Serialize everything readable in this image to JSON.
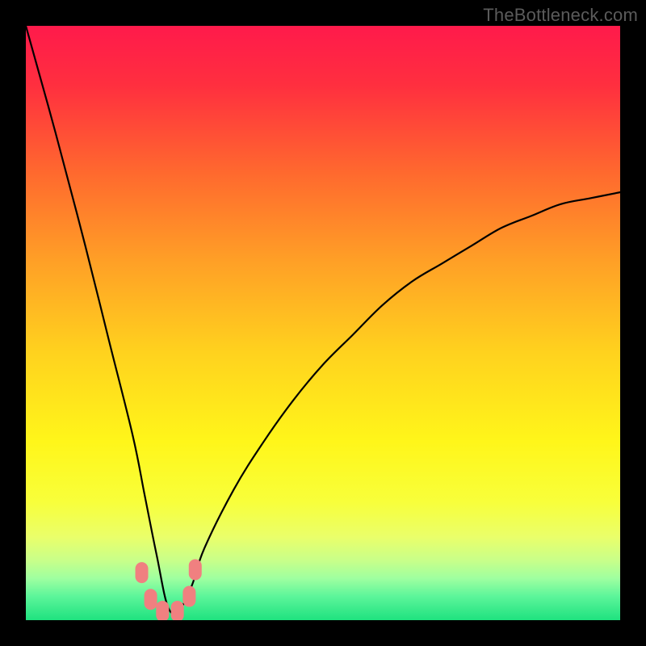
{
  "watermark": "TheBottleneck.com",
  "chart_data": {
    "type": "line",
    "title": "",
    "xlabel": "",
    "ylabel": "",
    "xlim": [
      0,
      100
    ],
    "ylim": [
      0,
      100
    ],
    "grid": false,
    "notes": "Single V-shaped bottleneck-percentage curve over a red-yellow-green heat gradient. Minimum (≈0) near x≈24 where small pink marker capsules sit; curve rises steeply to ≈100 at x=0 and more slowly toward ≈72 at x=100.",
    "series": [
      {
        "name": "bottleneck-curve",
        "x": [
          0,
          5,
          10,
          14,
          18,
          20,
          22,
          24,
          26,
          28,
          30,
          35,
          40,
          45,
          50,
          55,
          60,
          65,
          70,
          75,
          80,
          85,
          90,
          95,
          100
        ],
        "values": [
          100,
          82,
          63,
          47,
          31,
          21,
          11,
          2,
          2,
          6,
          12,
          22,
          30,
          37,
          43,
          48,
          53,
          57,
          60,
          63,
          66,
          68,
          70,
          71,
          72
        ]
      }
    ],
    "markers": {
      "name": "pink-dots",
      "color": "#f08080",
      "points": [
        {
          "x": 19.5,
          "y": 8.0
        },
        {
          "x": 21.0,
          "y": 3.5
        },
        {
          "x": 23.0,
          "y": 1.5
        },
        {
          "x": 25.5,
          "y": 1.5
        },
        {
          "x": 27.5,
          "y": 4.0
        },
        {
          "x": 28.5,
          "y": 8.5
        }
      ]
    },
    "gradient_stops": [
      {
        "offset": 0.0,
        "color": "#ff1a4b"
      },
      {
        "offset": 0.1,
        "color": "#ff2f3f"
      },
      {
        "offset": 0.25,
        "color": "#ff6a2e"
      },
      {
        "offset": 0.4,
        "color": "#ffa126"
      },
      {
        "offset": 0.55,
        "color": "#ffd21e"
      },
      {
        "offset": 0.7,
        "color": "#fff61a"
      },
      {
        "offset": 0.8,
        "color": "#f8ff3a"
      },
      {
        "offset": 0.86,
        "color": "#eaff6a"
      },
      {
        "offset": 0.9,
        "color": "#c8ff8a"
      },
      {
        "offset": 0.93,
        "color": "#9effa0"
      },
      {
        "offset": 0.96,
        "color": "#5cf59a"
      },
      {
        "offset": 1.0,
        "color": "#1fe27f"
      }
    ]
  }
}
